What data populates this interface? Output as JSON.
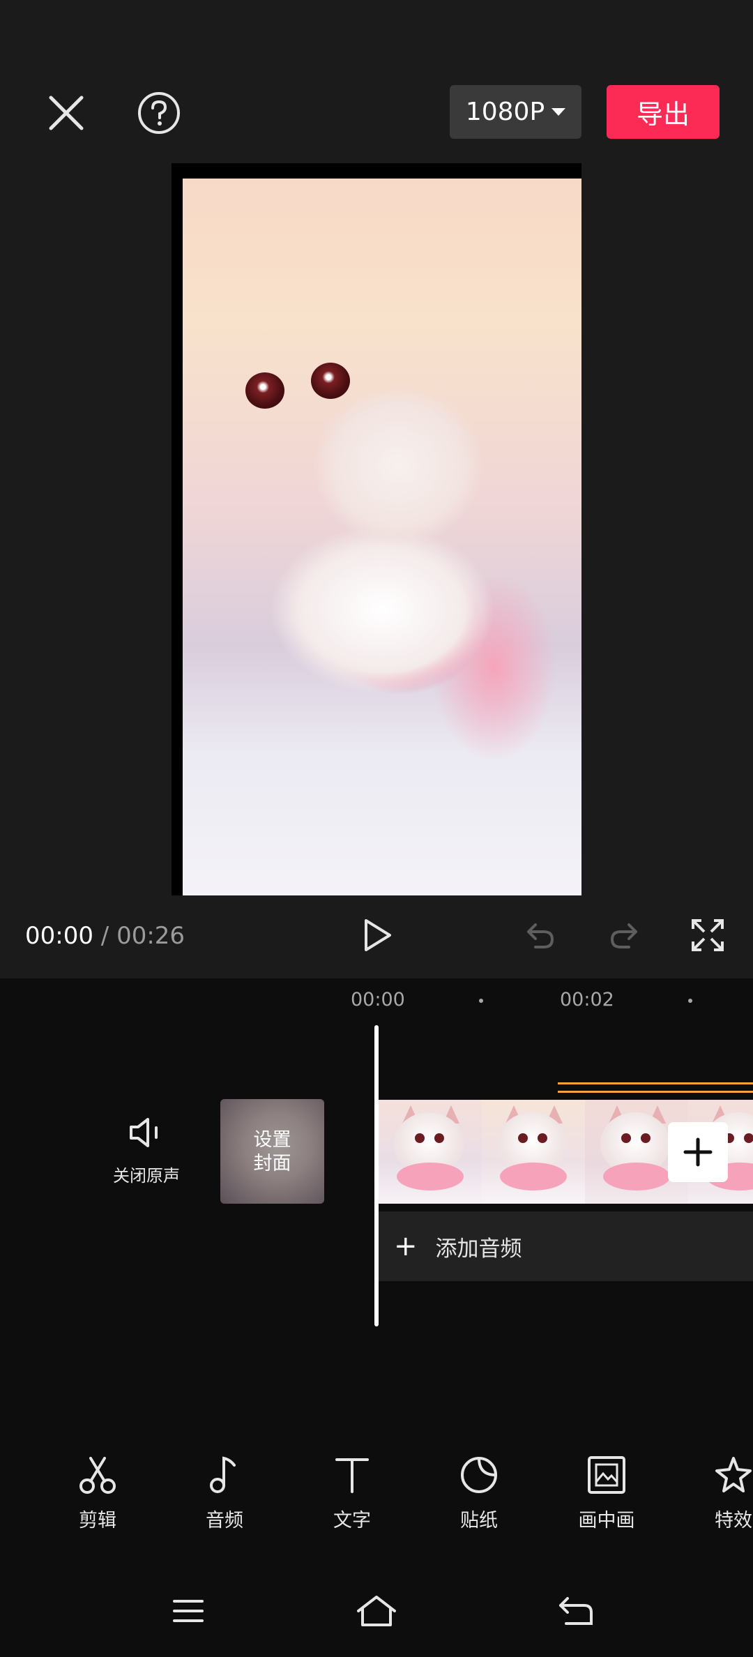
{
  "header": {
    "close_icon": "close-icon",
    "help_icon": "help-icon",
    "resolution": "1080P",
    "export_label": "导出"
  },
  "player": {
    "current_time": "00:00",
    "separator": "/",
    "total_time": "00:26",
    "controls": [
      "play-icon",
      "undo-icon",
      "redo-icon",
      "fullscreen-icon"
    ]
  },
  "timeline": {
    "ruler": [
      "00:00",
      "00:02"
    ],
    "mute_label": "关闭原声",
    "cover_label_line1": "设置",
    "cover_label_line2": "封面",
    "add_audio_label": "添加音频",
    "add_audio_plus": "+"
  },
  "toolbar": {
    "items": [
      {
        "label": "剪辑",
        "icon": "scissors-icon"
      },
      {
        "label": "音频",
        "icon": "music-note-icon"
      },
      {
        "label": "文字",
        "icon": "text-icon"
      },
      {
        "label": "贴纸",
        "icon": "sticker-icon"
      },
      {
        "label": "画中画",
        "icon": "picture-in-picture-icon"
      },
      {
        "label": "特效",
        "icon": "effects-star-icon"
      }
    ]
  },
  "system_nav": [
    "menu-icon",
    "home-icon",
    "back-icon"
  ],
  "colors": {
    "accent": "#fc2b55",
    "background": "#1b1b1b",
    "timeline_bg": "#0d0d0d",
    "audio_marker": "#f3a43a"
  }
}
